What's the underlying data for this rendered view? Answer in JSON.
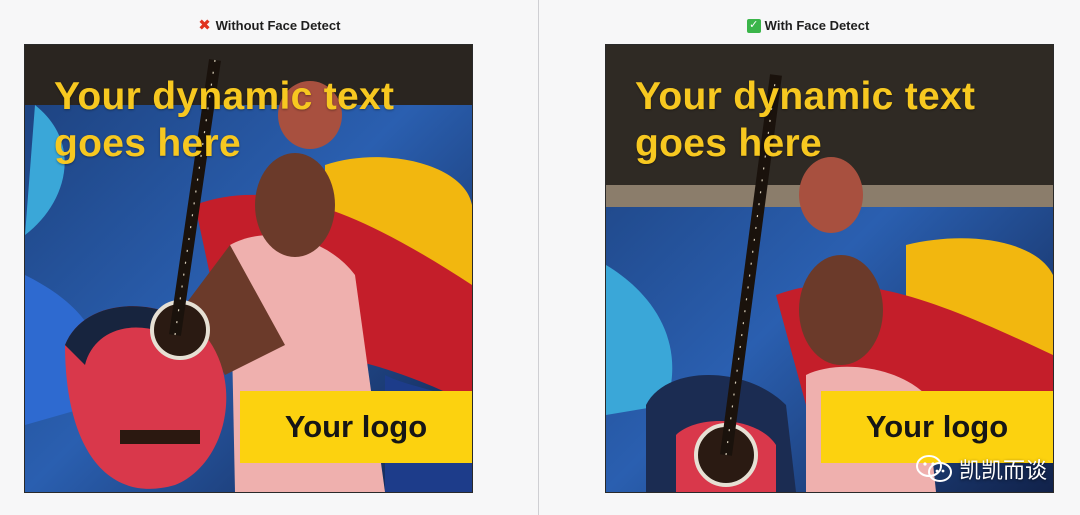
{
  "panels": {
    "left": {
      "title": "Without Face Detect",
      "status_icon": "cross-mark-icon"
    },
    "right": {
      "title": "With Face Detect",
      "status_icon": "check-mark-icon"
    }
  },
  "ad": {
    "headline": "Your dynamic text\ngoes here",
    "logo_label": "Your logo",
    "headline_color": "#f7c820",
    "logo_bg_color": "#fcd20f"
  },
  "watermark": {
    "icon": "wechat-icon",
    "text": "凯凯而谈"
  },
  "colors": {
    "page_bg": "#f7f7f8",
    "cross": "#e0321f",
    "check": "#3bb54a"
  }
}
